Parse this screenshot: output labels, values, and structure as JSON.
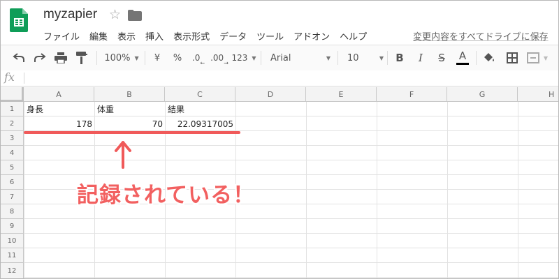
{
  "document": {
    "title": "myzapier"
  },
  "menu": {
    "items": [
      "ファイル",
      "編集",
      "表示",
      "挿入",
      "表示形式",
      "データ",
      "ツール",
      "アドオン",
      "ヘルプ"
    ],
    "save_status": "変更内容をすべてドライブに保存"
  },
  "toolbar": {
    "zoom": "100%",
    "currency": "¥",
    "percent": "%",
    "decimal_decrease": ".0",
    "decimal_increase": ".00",
    "more_formats": "123",
    "font": "Arial",
    "font_size": "10",
    "bold": "B",
    "italic": "I",
    "strikethrough": "S",
    "text_color": "A",
    "text_color_swatch": "#000000"
  },
  "formula_bar": {
    "fx_label": "fx",
    "value": ""
  },
  "columns": [
    "A",
    "B",
    "C",
    "D",
    "E",
    "F",
    "G",
    "H"
  ],
  "rows": [
    "1",
    "2",
    "3",
    "4",
    "5",
    "6",
    "7",
    "8",
    "9",
    "10",
    "11",
    "12"
  ],
  "cells": {
    "A1": "身長",
    "B1": "体重",
    "C1": "結果",
    "A2": "178",
    "B2": "70",
    "C2": "22.09317005"
  },
  "annotation": {
    "text": "記録されている！",
    "color": "#f05a5a"
  },
  "colors": {
    "sheets_green": "#0f9d58",
    "header_bg": "#f3f3f3"
  }
}
